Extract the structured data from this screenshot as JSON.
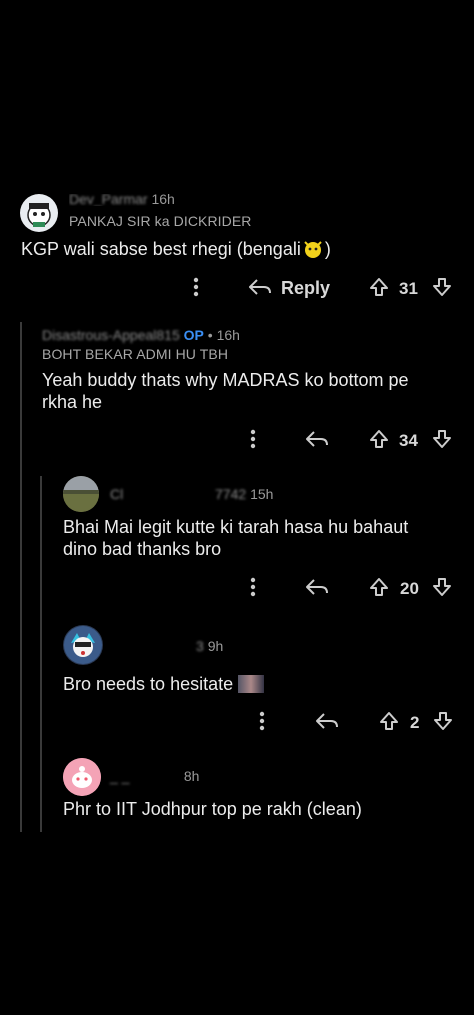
{
  "comments": [
    {
      "username": "Dev_Parmar",
      "time": "16h",
      "flair": "PANKAJ SIR ka DICKRIDER",
      "text": "KGP wali sabse best rhegi (bengali",
      "text_end": ")",
      "reply_label": "Reply",
      "votes": "31"
    },
    {
      "username": "Disastrous-Appeal815",
      "op_badge": "OP",
      "separator": "•",
      "time": "16h",
      "flair": "BOHT BEKAR ADMI HU TBH",
      "text": "Yeah buddy thats why MADRAS ko bottom pe rkha he",
      "votes": "34"
    },
    {
      "username_start": "Cl",
      "username_end": "7742",
      "time": "15h",
      "text": "Bhai Mai legit kutte ki tarah hasa hu bahaut dino bad thanks bro",
      "votes": "20"
    },
    {
      "username_end": "3",
      "time": "9h",
      "text": "Bro needs to hesitate",
      "votes": "2"
    },
    {
      "username": "_ _",
      "time": "8h",
      "text": "Phr to IIT Jodhpur top pe rakh (clean)"
    }
  ],
  "colors": {
    "background": "#000000",
    "op_badge": "#3a8ff5",
    "text": "#ececec",
    "muted": "#9a9a9a"
  },
  "icons": [
    "more-icon",
    "reply-icon",
    "upvote-icon",
    "downvote-icon"
  ]
}
